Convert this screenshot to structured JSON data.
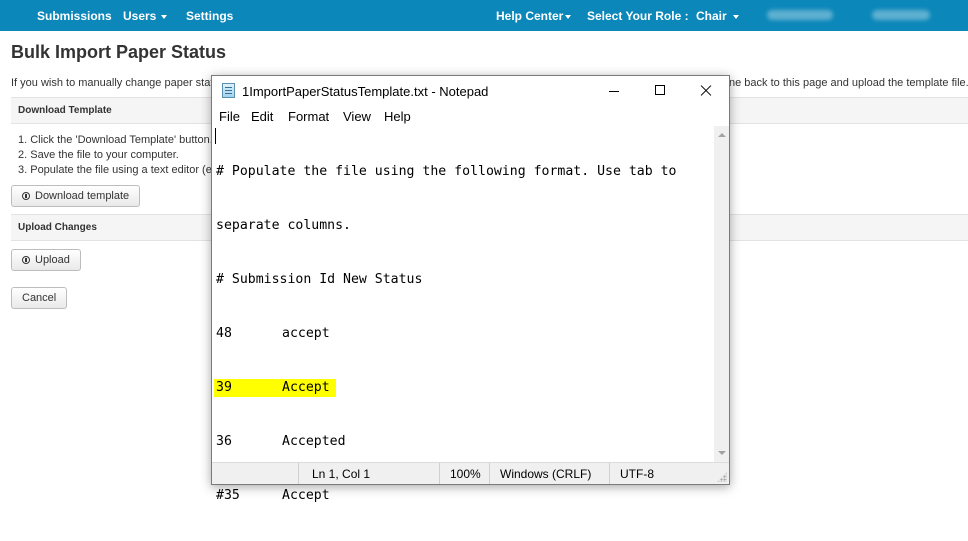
{
  "nav": {
    "submissions": "Submissions",
    "users": "Users",
    "settings": "Settings",
    "help_center": "Help Center",
    "select_role_label": "Select Your Role :",
    "role": "Chair"
  },
  "page": {
    "title": "Bulk Import Paper Status",
    "intro_left": "If you wish to manually change paper statu",
    "intro_right": "ne back to this page and upload the template file.",
    "download_section_title": "Download Template",
    "steps": [
      "1. Click the 'Download Template' button.",
      "2. Save the file to your computer.",
      "3. Populate the file using a text editor (e.g"
    ],
    "download_button": "Download template",
    "upload_section_title": "Upload Changes",
    "upload_button": "Upload",
    "cancel_button": "Cancel"
  },
  "notepad": {
    "title": "1ImportPaperStatusTemplate.txt - Notepad",
    "menu": [
      "File",
      "Edit",
      "Format",
      "View",
      "Help"
    ],
    "lines": [
      "# Populate the file using the following format. Use tab to",
      "separate columns.",
      "# Submission Id New Status"
    ],
    "rows": [
      {
        "id": "48",
        "status": "accept",
        "highlighted": false
      },
      {
        "id": "39",
        "status": "Accept",
        "highlighted": true
      },
      {
        "id": "36",
        "status": "Accepted",
        "highlighted": false
      },
      {
        "id": "#35",
        "status": "Accept",
        "highlighted": false
      }
    ],
    "highlight_color": "#ffff00",
    "status": {
      "position": "Ln 1, Col 1",
      "zoom": "100%",
      "line_ending": "Windows (CRLF)",
      "encoding": "UTF-8"
    }
  },
  "colors": {
    "nav_bg": "#0b87b9",
    "section_bg": "#f5f5f5"
  }
}
